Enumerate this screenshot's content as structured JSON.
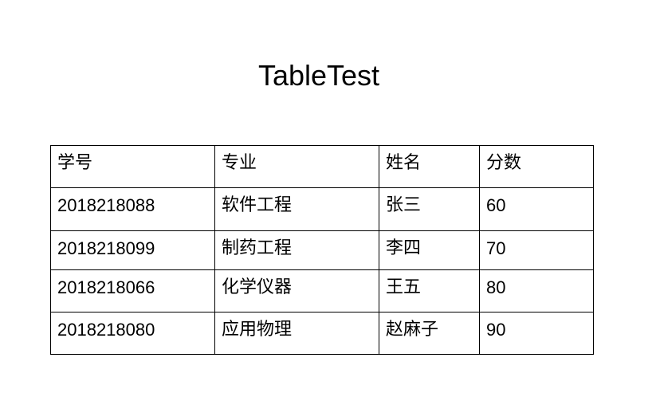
{
  "page": {
    "title": "TableTest"
  },
  "table": {
    "headers": [
      "学号",
      "专业",
      "姓名",
      "分数"
    ],
    "rows": [
      [
        "2018218088",
        "软件工程",
        "张三",
        "60"
      ],
      [
        "2018218099",
        "制药工程",
        "李四",
        "70"
      ],
      [
        "2018218066",
        "化学仪器",
        "王五",
        "80"
      ],
      [
        "2018218080",
        "应用物理",
        "赵麻子",
        "90"
      ]
    ]
  }
}
